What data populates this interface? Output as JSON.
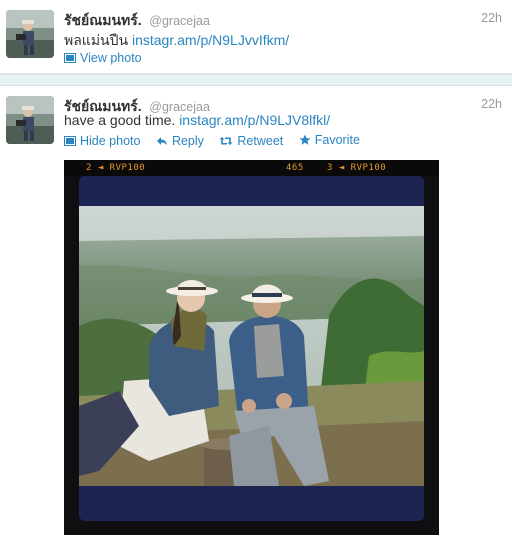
{
  "tweets": [
    {
      "fullname": "รัชย์ณมนทร์.",
      "username": "@gracejaa",
      "time": "22h",
      "text": "พลแม่นปืน",
      "link": "instagr.am/p/N9LJvvIfkm/",
      "actions": {
        "view_photo": "View photo"
      }
    },
    {
      "fullname": "รัชย์ณมนทร์.",
      "username": "@gracejaa",
      "time": "22h",
      "text": "have a good time.",
      "link": "instagr.am/p/N9LJV8lfkl/",
      "actions": {
        "hide_photo": "Hide photo",
        "reply": "Reply",
        "retweet": "Retweet",
        "favorite": "Favorite"
      },
      "media": {
        "film_left": "2 ◄  RVP100",
        "film_mid": "465",
        "film_right": "3 ◄  RVP100"
      }
    }
  ],
  "colors": {
    "link": "#2a85c0",
    "film_text": "#e69a2b",
    "frame": "#1c2452"
  }
}
